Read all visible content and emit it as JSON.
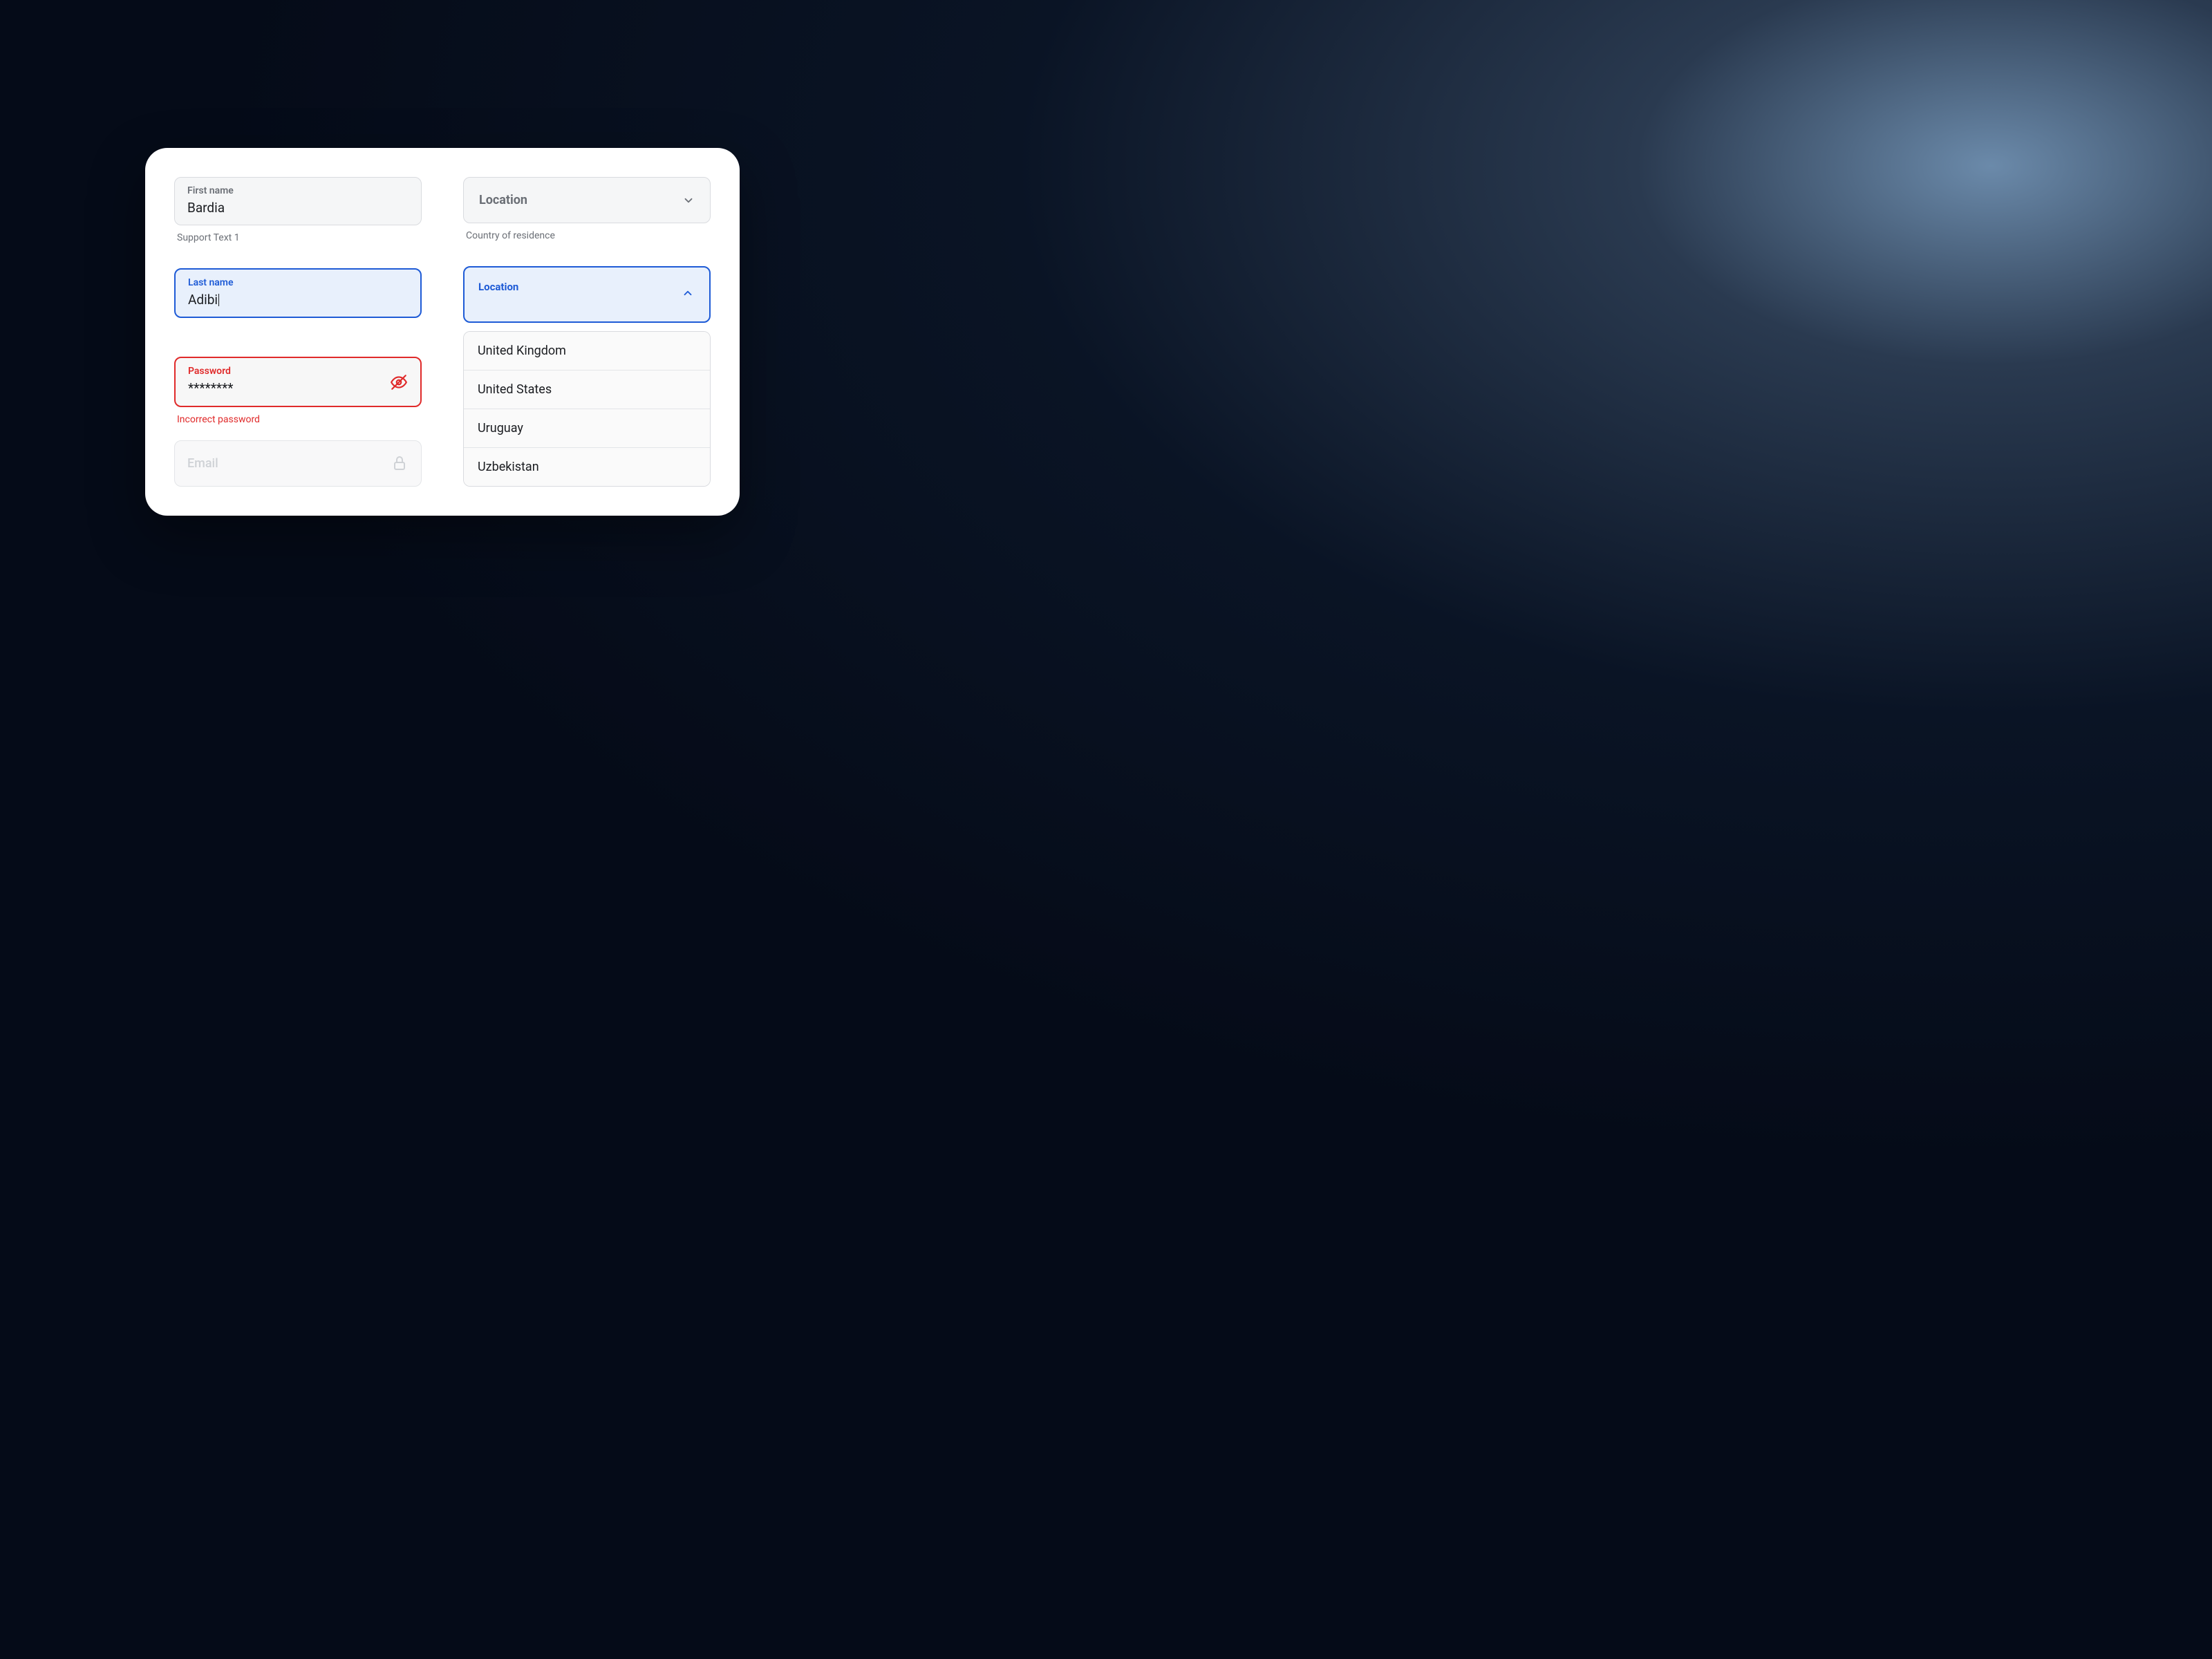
{
  "left": {
    "first_name": {
      "label": "First name",
      "value": "Bardia"
    },
    "first_name_support": "Support Text 1",
    "last_name": {
      "label": "Last name",
      "value": "Adibi"
    },
    "password": {
      "label": "Password",
      "value": "********"
    },
    "password_error": "Incorrect password",
    "email": {
      "label": "Email"
    }
  },
  "right": {
    "location_closed": {
      "label": "Location"
    },
    "location_support": "Country of residence",
    "location_open": {
      "label": "Location"
    },
    "options": [
      "United Kingdom",
      "United States",
      "Uruguay",
      "Uzbekistan"
    ]
  },
  "colors": {
    "accent": "#1e5bd6",
    "error": "#e02a2a",
    "muted": "#6b6f76"
  }
}
